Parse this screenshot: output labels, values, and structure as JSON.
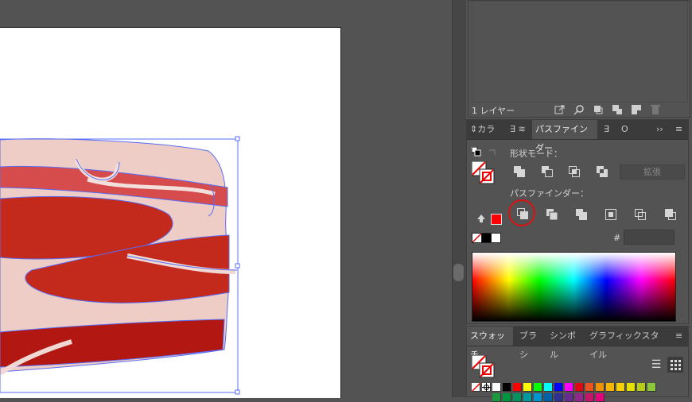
{
  "layers_panel": {
    "count_label": "1 レイヤー",
    "icons": [
      "export-icon",
      "search-icon",
      "clip-icon",
      "new-sublayer-icon",
      "new-layer-icon",
      "trash-icon"
    ]
  },
  "color_panel": {
    "tab_label": "カラー"
  },
  "pathfinder_panel": {
    "tabs": [
      "パスファインダー",
      "O"
    ],
    "shape_modes_label": "形状モード：",
    "expand_label": "拡張",
    "pathfinders_label": "パスファインダー：",
    "hex_label": "#",
    "hex_value": ""
  },
  "swatches_panel": {
    "tabs": [
      "スウォッチ",
      "ブラシ",
      "シンボル",
      "グラフィックスタイル"
    ],
    "colors_row1": [
      "#ffffff",
      "#000000",
      "#ff0000",
      "#ffff00",
      "#00ff00",
      "#00ffff",
      "#0000ff",
      "#ff00ff",
      "#e30613",
      "#e8531f",
      "#f39200",
      "#f7b500",
      "#f7d000",
      "#e3e000",
      "#b5cc18",
      "#8cc63f"
    ],
    "colors_row2": [
      "#1a9a3a",
      "#009640",
      "#00935f",
      "#009a9f",
      "#0096d6",
      "#0061a8",
      "#2e3192",
      "#662d91",
      "#92278f",
      "#c3166b",
      "#e6007e"
    ]
  },
  "colors": {
    "accent_red": "#ff0000",
    "selection_blue": "#4b6bff",
    "highlight_circle": "#e01010"
  }
}
